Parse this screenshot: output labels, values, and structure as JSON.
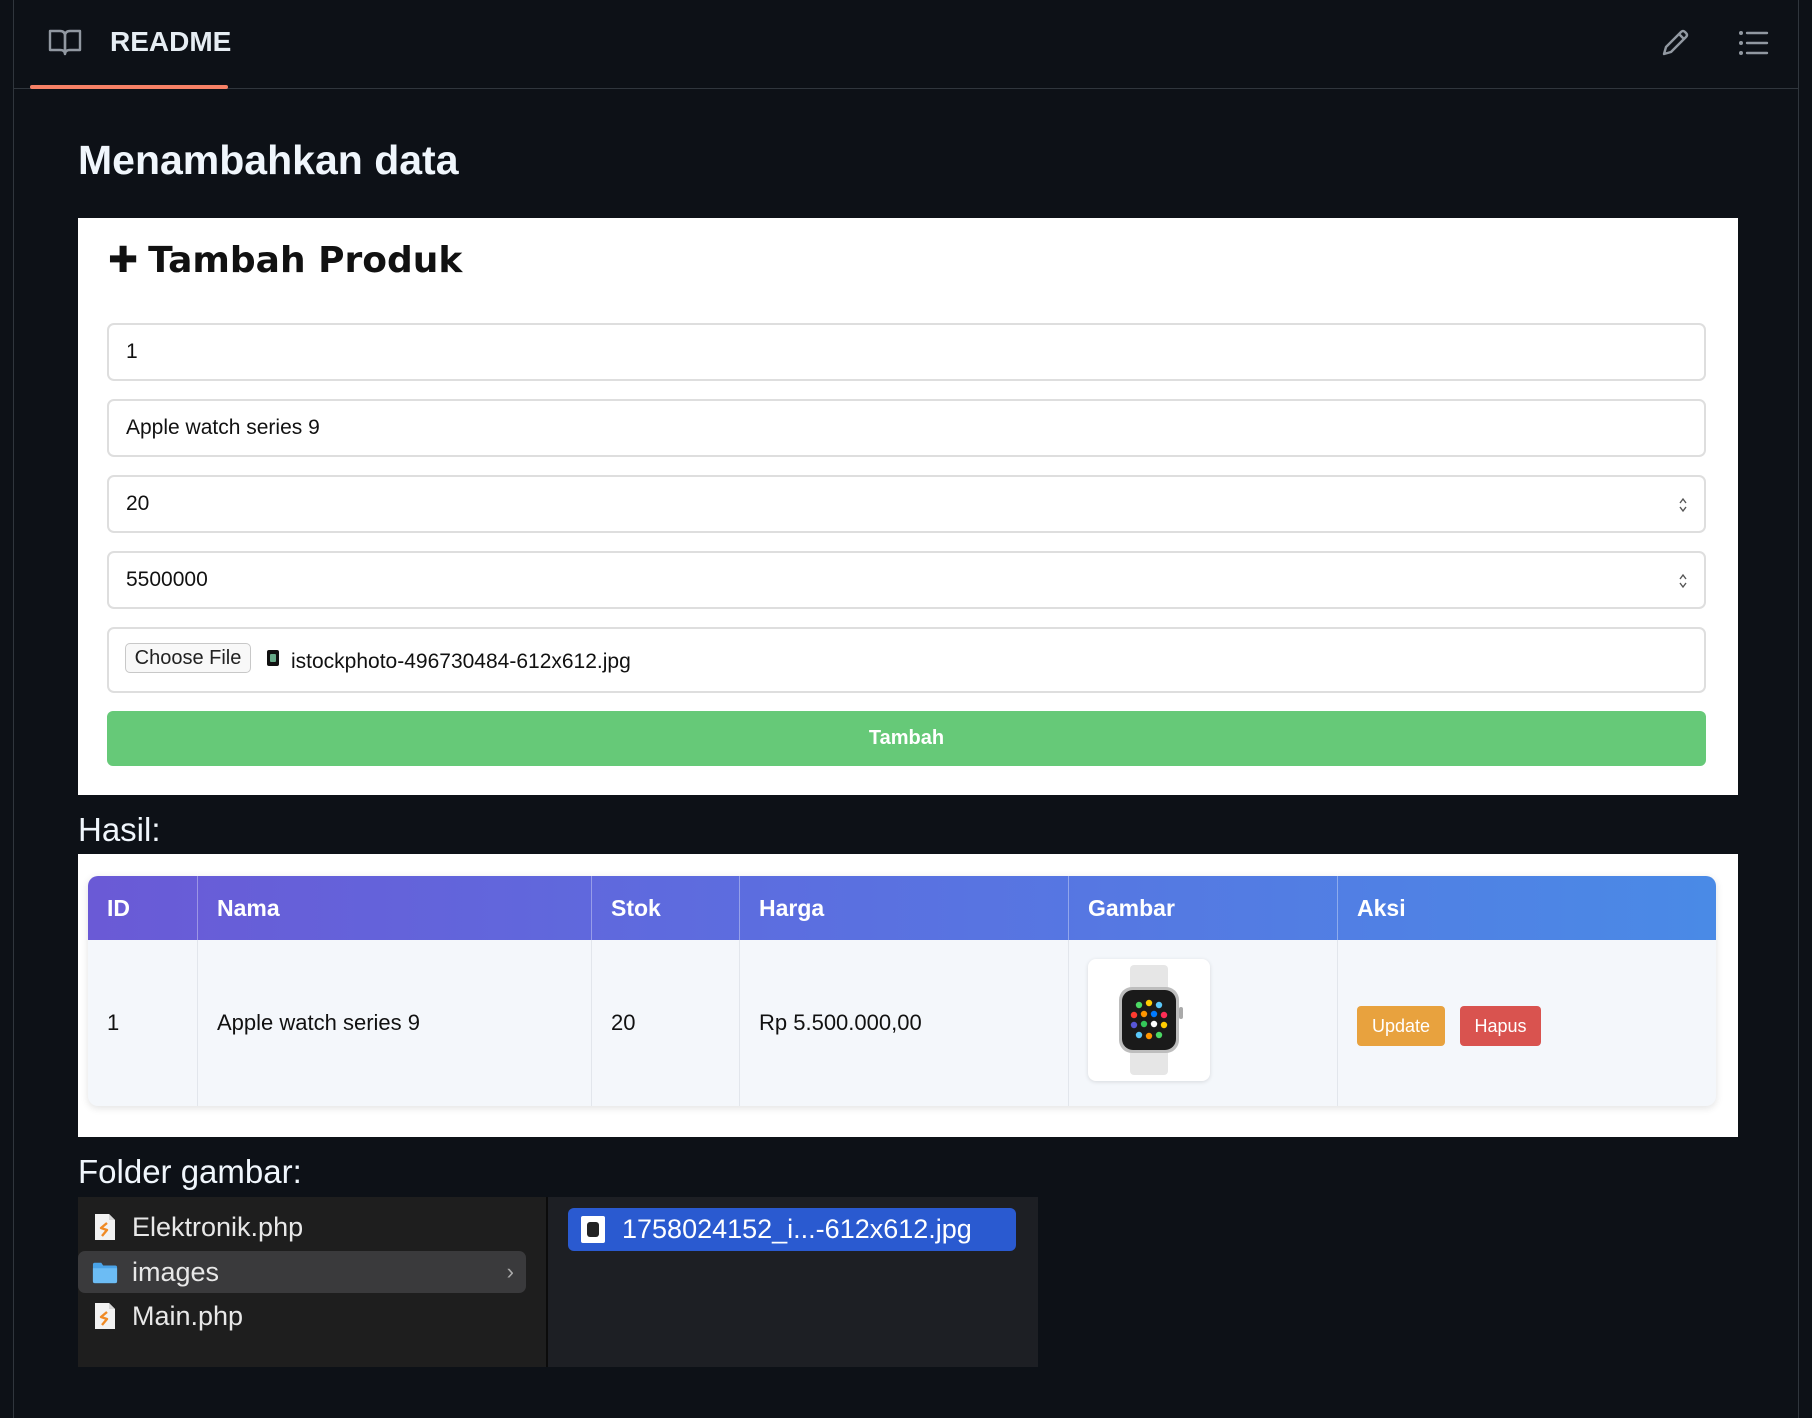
{
  "header": {
    "tab_label": "README"
  },
  "page_title": "Menambahkan data",
  "form": {
    "title": "Tambah Produk",
    "fields": {
      "id": "1",
      "nama": "Apple watch series 9",
      "stok": "20",
      "harga": "5500000"
    },
    "file": {
      "button_label": "Choose File",
      "file_name": "istockphoto-496730484-612x612.jpg"
    },
    "submit_label": "Tambah"
  },
  "hasil_label": "Hasil:",
  "table": {
    "headers": [
      "ID",
      "Nama",
      "Stok",
      "Harga",
      "Gambar",
      "Aksi"
    ],
    "rows": [
      {
        "id": "1",
        "nama": "Apple watch series 9",
        "stok": "20",
        "harga": "Rp 5.500.000,00",
        "update_label": "Update",
        "hapus_label": "Hapus"
      }
    ]
  },
  "folder_label": "Folder gambar:",
  "finder": {
    "items": [
      {
        "name": "Elektronik.php",
        "icon": "php-file-icon"
      },
      {
        "name": "images",
        "icon": "folder-icon",
        "selected": true
      },
      {
        "name": "Main.php",
        "icon": "php-file-icon"
      }
    ],
    "selected_file": "1758024152_i...-612x612.jpg"
  },
  "colors": {
    "accent_underline": "#f78166",
    "submit_green": "#66c978",
    "update_orange": "#e8a23e",
    "hapus_red": "#d9534f",
    "finder_selection": "#2a5ad0"
  }
}
